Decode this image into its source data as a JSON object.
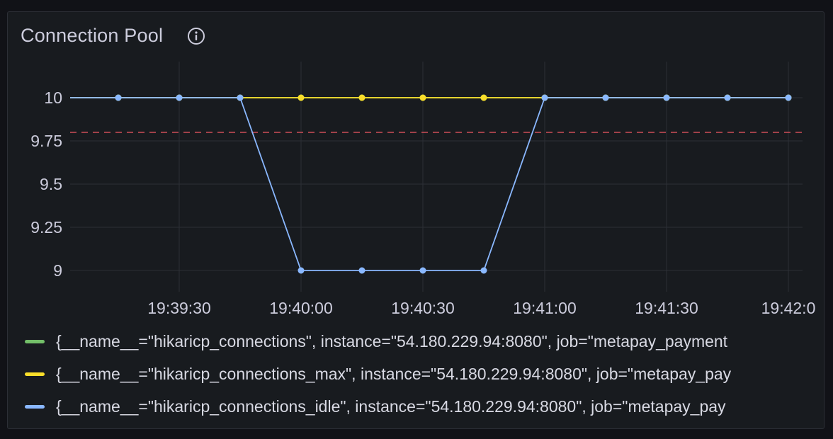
{
  "panel": {
    "title": "Connection Pool",
    "info_icon": "info-circle-icon"
  },
  "chart_data": {
    "type": "line",
    "title": "Connection Pool",
    "x": [
      "19:39:15",
      "19:39:30",
      "19:39:45",
      "19:40:00",
      "19:40:15",
      "19:40:30",
      "19:40:45",
      "19:41:00",
      "19:41:15",
      "19:41:30",
      "19:41:45",
      "19:42:00"
    ],
    "x_ticks": [
      "19:39:30",
      "19:40:00",
      "19:40:30",
      "19:41:00",
      "19:41:30",
      "19:42:0"
    ],
    "y_ticks": [
      "10",
      "9.75",
      "9.5",
      "9.25",
      "9"
    ],
    "ylim": [
      9,
      10
    ],
    "grid": true,
    "threshold": 9.8,
    "threshold_color": "#e0535e",
    "series": [
      {
        "name": "{__name__=\"hikaricp_connections\", instance=\"54.180.229.94:8080\", job=\"metapay_payment",
        "color": "#73bf69",
        "values": [
          10,
          10,
          10,
          10,
          10,
          10,
          10,
          10,
          10,
          10,
          10,
          10
        ]
      },
      {
        "name": "{__name__=\"hikaricp_connections_max\", instance=\"54.180.229.94:8080\", job=\"metapay_pay",
        "color": "#fade2a",
        "values": [
          10,
          10,
          10,
          10,
          10,
          10,
          10,
          10,
          10,
          10,
          10,
          10
        ]
      },
      {
        "name": "{__name__=\"hikaricp_connections_idle\", instance=\"54.180.229.94:8080\", job=\"metapay_pay",
        "color": "#8ab8ff",
        "values": [
          10,
          10,
          10,
          9,
          9,
          9,
          9,
          10,
          10,
          10,
          10,
          10
        ]
      }
    ],
    "legend_position": "bottom"
  },
  "colors": {
    "background": "#181b1f",
    "grid": "#2c2f36",
    "text": "#ccccdc"
  }
}
